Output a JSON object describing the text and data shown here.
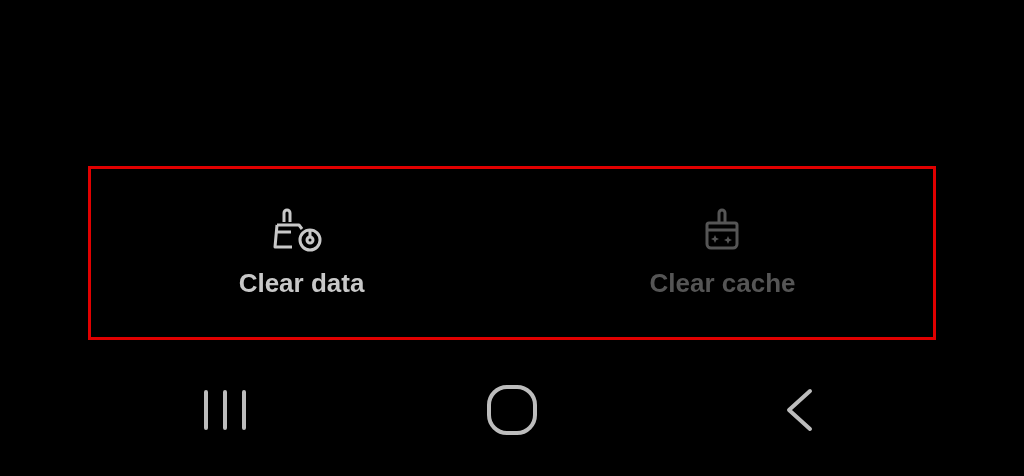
{
  "action_bar": {
    "highlighted": true,
    "actions": [
      {
        "kind": "clear-data",
        "label": "Clear data",
        "disabled": false
      },
      {
        "kind": "clear-cache",
        "label": "Clear cache",
        "disabled": true
      }
    ]
  },
  "navigation_bar": {
    "buttons": [
      {
        "kind": "recents"
      },
      {
        "kind": "home"
      },
      {
        "kind": "back"
      }
    ]
  }
}
